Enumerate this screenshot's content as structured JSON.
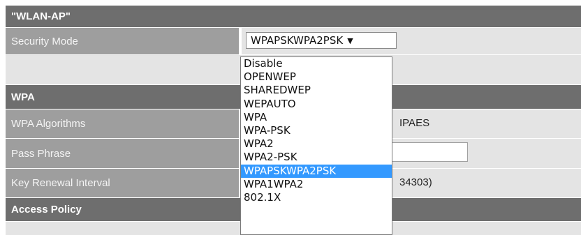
{
  "wlan_header": "\"WLAN-AP\"",
  "security_mode": {
    "label": "Security Mode",
    "selected": "WPAPSKWPA2PSK",
    "options": [
      "Disable",
      "OPENWEP",
      "SHAREDWEP",
      "WEPAUTO",
      "WPA",
      "WPA-PSK",
      "WPA2",
      "WPA2-PSK",
      "WPAPSKWPA2PSK",
      "WPA1WPA2",
      "802.1X"
    ]
  },
  "wpa_header": "WPA",
  "wpa_algorithms": {
    "label": "WPA Algorithms",
    "visible_value": "IPAES"
  },
  "pass_phrase": {
    "label": "Pass Phrase",
    "value": ""
  },
  "key_renewal": {
    "label": "Key Renewal Interval",
    "visible_value": "34303)"
  },
  "access_policy_header": "Access Policy"
}
